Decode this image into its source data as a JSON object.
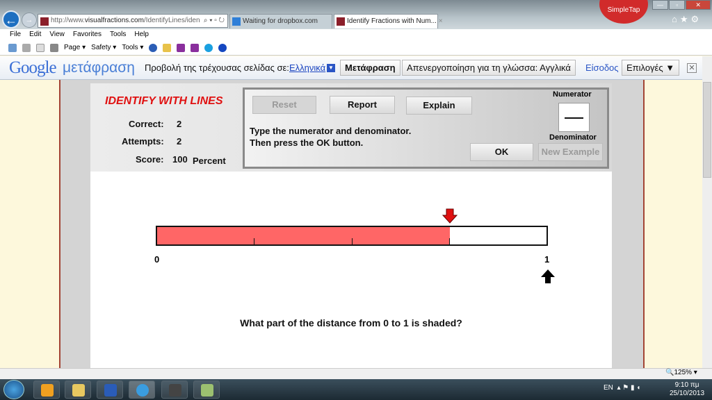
{
  "browser": {
    "address_domain": "visualfractions.com",
    "address_prefix": "http://www.",
    "address_suffix": "/IdentifyLines/iden",
    "tabs": [
      {
        "label": "Waiting for dropbox.com"
      },
      {
        "label": "Identify Fractions with Num...",
        "close": "×"
      }
    ],
    "simpletap": "SimpleTap",
    "menu": [
      "File",
      "Edit",
      "View",
      "Favorites",
      "Tools",
      "Help"
    ],
    "commands": [
      "Page ▾",
      "Safety ▾",
      "Tools ▾"
    ]
  },
  "google_bar": {
    "logo": "Google",
    "product": "μετάφραση",
    "view_label": "Προβολή της τρέχουσας σελίδας σε:",
    "language": "Ελληνικά",
    "translate_button": "Μετάφραση",
    "disable_button": "Απενεργοποίηση για τη γλώσσα: Αγγλικά",
    "sign_in": "Είσοδος",
    "options_button": "Επιλογές ▼",
    "close": "✕"
  },
  "app": {
    "title": "IDENTIFY WITH LINES",
    "stats": {
      "correct_label": "Correct:",
      "correct": "2",
      "attempts_label": "Attempts:",
      "attempts": "2",
      "score_label": "Score:",
      "score": "100",
      "score_unit": "Percent"
    },
    "buttons": {
      "reset": "Reset",
      "report": "Report",
      "explain": "Explain",
      "ok": "OK",
      "new_example": "New Example"
    },
    "instructions": [
      "Type the numerator and denominator.",
      "Then press the OK button."
    ],
    "numerator_label": "Numerator",
    "denominator_label": "Denominator",
    "numberline": {
      "start_label": "0",
      "end_label": "1",
      "divisions": 4,
      "shaded_parts": 3,
      "fill_color": "#ff6666"
    },
    "question": "What part of the distance from 0 to 1 is shaded?"
  },
  "status": {
    "zoom": "125%"
  },
  "taskbar": {
    "language": "EN",
    "time": "9:10 πμ",
    "date": "25/10/2013"
  }
}
